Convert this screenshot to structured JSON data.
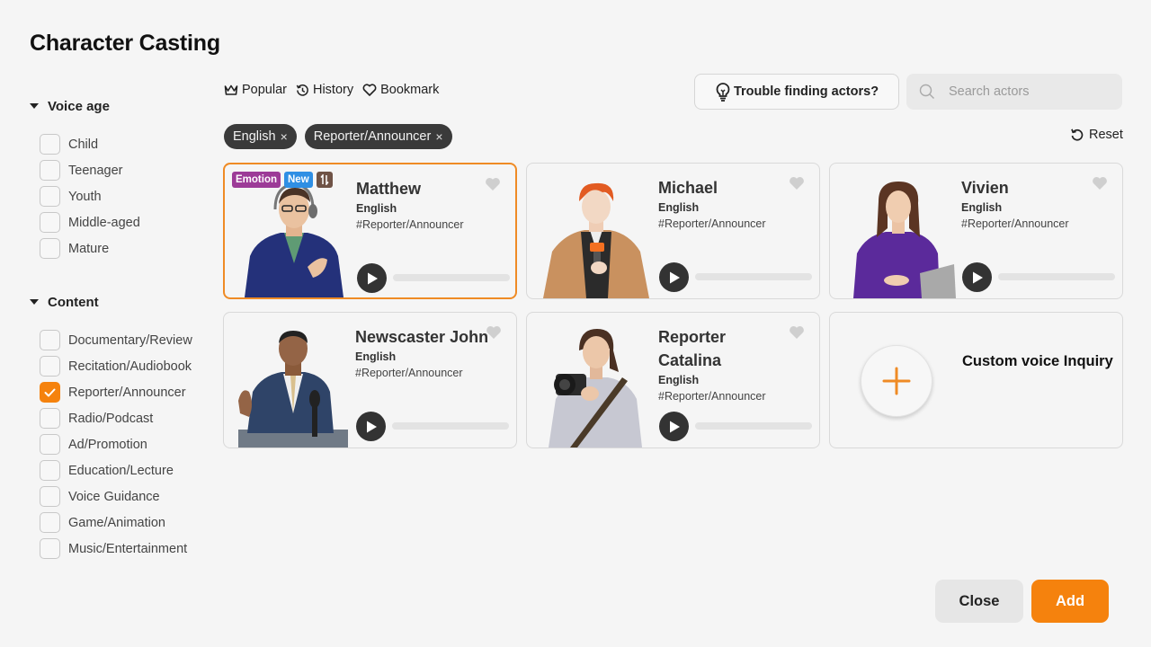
{
  "title": "Character Casting",
  "sidebar": {
    "groups": [
      {
        "label": "Voice age",
        "options": [
          {
            "label": "Child",
            "checked": false
          },
          {
            "label": "Teenager",
            "checked": false
          },
          {
            "label": "Youth",
            "checked": false
          },
          {
            "label": "Middle-aged",
            "checked": false
          },
          {
            "label": "Mature",
            "checked": false
          }
        ]
      },
      {
        "label": "Content",
        "options": [
          {
            "label": "Documentary/Review",
            "checked": false
          },
          {
            "label": "Recitation/Audiobook",
            "checked": false
          },
          {
            "label": "Reporter/Announcer",
            "checked": true
          },
          {
            "label": "Radio/Podcast",
            "checked": false
          },
          {
            "label": "Ad/Promotion",
            "checked": false
          },
          {
            "label": "Education/Lecture",
            "checked": false
          },
          {
            "label": "Voice Guidance",
            "checked": false
          },
          {
            "label": "Game/Animation",
            "checked": false
          },
          {
            "label": "Music/Entertainment",
            "checked": false
          }
        ]
      }
    ]
  },
  "topnav": {
    "items": [
      {
        "label": "Popular",
        "icon": "crown-icon"
      },
      {
        "label": "History",
        "icon": "history-icon"
      },
      {
        "label": "Bookmark",
        "icon": "heart-outline-icon"
      }
    ]
  },
  "trouble_button": {
    "label": "Trouble finding actors?",
    "icon": "lightbulb-icon"
  },
  "search": {
    "placeholder": "Search actors",
    "value": ""
  },
  "filters": {
    "chips": [
      {
        "label": "English"
      },
      {
        "label": "Reporter/Announcer"
      }
    ],
    "remove_glyph": "×",
    "reset_label": "Reset"
  },
  "actors": [
    {
      "name": "Matthew",
      "language": "English",
      "tag": "#Reporter/Announcer",
      "selected": true,
      "bookmarked": false,
      "badges": [
        "Emotion",
        "New"
      ],
      "progress": 0
    },
    {
      "name": "Michael",
      "language": "English",
      "tag": "#Reporter/Announcer",
      "selected": false,
      "bookmarked": false,
      "badges": [],
      "progress": 0
    },
    {
      "name": "Vivien",
      "language": "English",
      "tag": "#Reporter/Announcer",
      "selected": false,
      "bookmarked": false,
      "badges": [],
      "progress": 0
    },
    {
      "name": "Newscaster John",
      "language": "English",
      "tag": "#Reporter/Announcer",
      "selected": false,
      "bookmarked": false,
      "badges": [],
      "progress": 0
    },
    {
      "name": "Reporter Catalina",
      "language": "English",
      "tag": "#Reporter/Announcer",
      "selected": false,
      "bookmarked": false,
      "badges": [],
      "progress": 0
    }
  ],
  "custom_voice": {
    "label": "Custom voice Inquiry"
  },
  "footer": {
    "close_label": "Close",
    "add_label": "Add"
  },
  "colors": {
    "accent": "#f5820d",
    "emotion_badge": "#9c3b97",
    "new_badge": "#2f8fe4",
    "chip_bg": "#3a3a3a"
  }
}
